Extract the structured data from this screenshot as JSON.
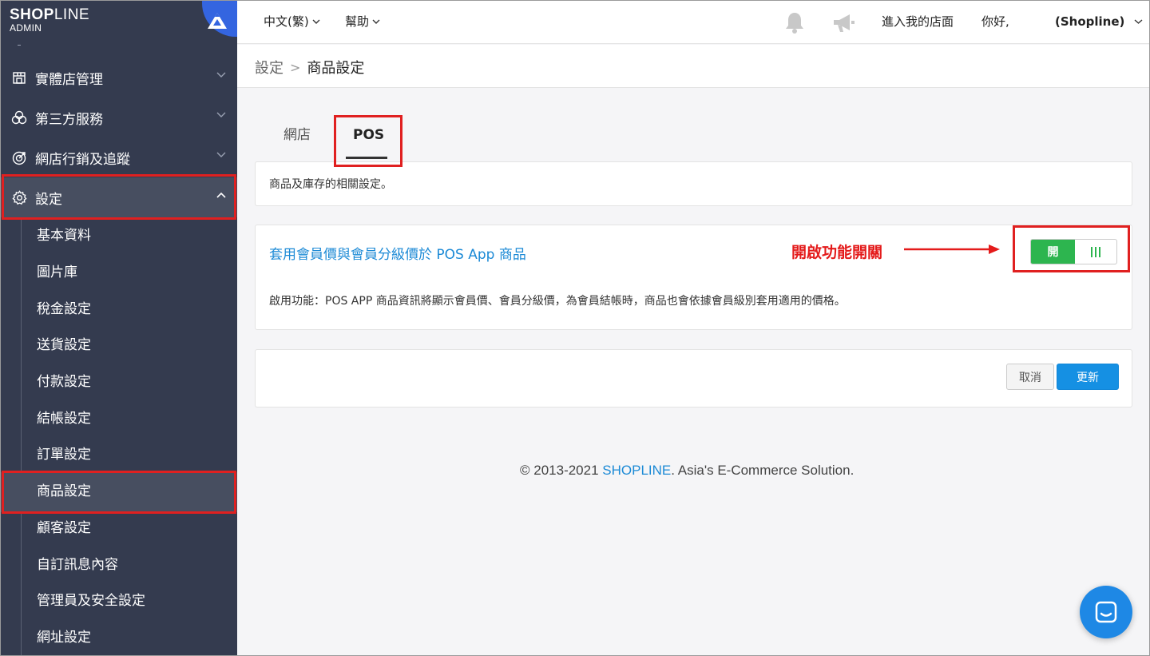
{
  "app": {
    "logo_main_bold": "SHOP",
    "logo_main_light": "LINE",
    "logo_sub": "ADMIN"
  },
  "sidebar": {
    "items": [
      {
        "label": "實體店管理",
        "icon": "store-icon"
      },
      {
        "label": "第三方服務",
        "icon": "services-icon"
      },
      {
        "label": "網店行銷及追蹤",
        "icon": "target-icon"
      },
      {
        "label": "設定",
        "icon": "gear-icon",
        "expanded": true
      }
    ],
    "sub_items": [
      "基本資料",
      "圖片庫",
      "稅金設定",
      "送貨設定",
      "付款設定",
      "結帳設定",
      "訂單設定",
      "商品設定",
      "顧客設定",
      "自訂訊息內容",
      "管理員及安全設定",
      "網址設定"
    ],
    "active_sub": "商品設定"
  },
  "topbar": {
    "language": "中文(繁)",
    "help": "幫助",
    "enter_store": "進入我的店面",
    "greeting": "你好,",
    "user": "(Shopline)",
    "icons": [
      "bell-icon",
      "megaphone-icon"
    ]
  },
  "breadcrumb": {
    "parent": "設定",
    "separator": ">",
    "current": "商品設定"
  },
  "tabs": {
    "web": "網店",
    "pos": "POS",
    "active": "POS"
  },
  "description": "商品及庫存的相關設定。",
  "feature": {
    "title": "套用會員價與會員分級價於 POS App 商品",
    "annotation": "開啟功能開關",
    "toggle_on_label": "開",
    "toggle_state": true,
    "description": "啟用功能：POS APP 商品資訊將顯示會員價、會員分級價，為會員結帳時，商品也會依據會員級別套用適用的價格。"
  },
  "actions": {
    "cancel": "取消",
    "update": "更新"
  },
  "footer": {
    "prefix": "© 2013-2021 ",
    "brand": "SHOPLINE",
    "suffix": ". Asia's E-Commerce Solution."
  },
  "colors": {
    "sidebar_bg": "#343b4f",
    "accent_blue": "#1590e3",
    "toggle_green": "#2db54f",
    "annotation_red": "#e41b1b"
  }
}
